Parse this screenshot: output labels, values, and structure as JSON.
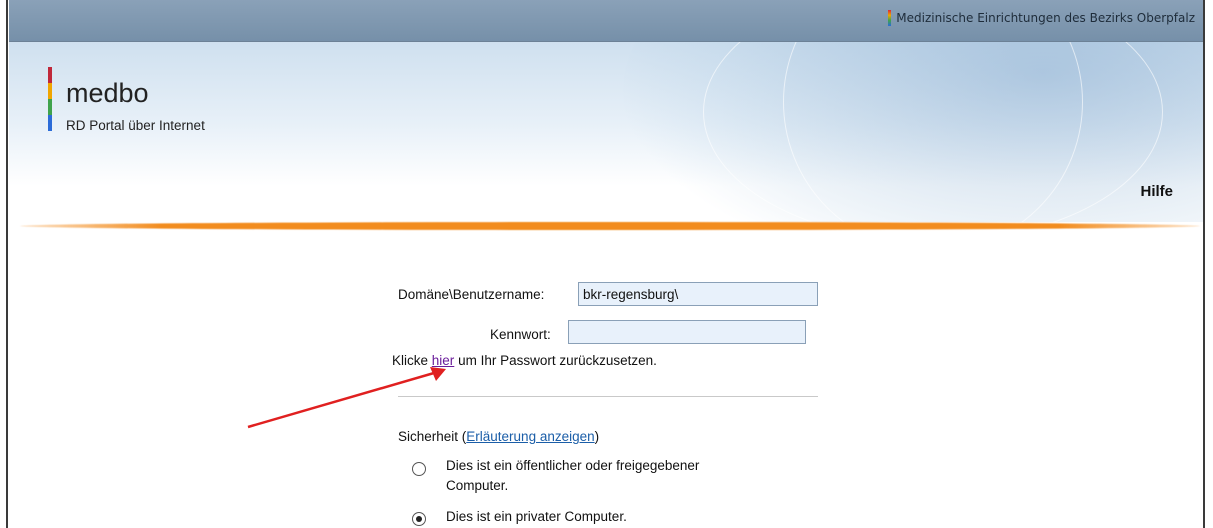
{
  "header": {
    "tagline": "Medizinische Einrichtungen des Bezirks Oberpfalz"
  },
  "brand": {
    "name": "medbo",
    "subtitle": "RD Portal über Internet"
  },
  "nav": {
    "help": "Hilfe"
  },
  "form": {
    "username_label": "Domäne\\Benutzername:",
    "username_value": "bkr-regensburg\\",
    "password_label": "Kennwort:",
    "password_value": "",
    "reset_prefix": "Klicke",
    "reset_link": "hier",
    "reset_suffix": "um Ihr Passwort zurückzusetzen.",
    "security_label": "Sicherheit (",
    "security_link": "Erläuterung anzeigen",
    "security_close": ")",
    "option_public": "Dies ist ein öffentlicher oder freigegebener",
    "option_public_line2": "Computer.",
    "option_private": "Dies ist ein privater Computer.",
    "selected_option": "private"
  },
  "colors": {
    "accent": "#f28c1e",
    "link": "#1b5ea8",
    "visited_link": "#6a1b9a",
    "annotation_arrow": "#e02020"
  }
}
